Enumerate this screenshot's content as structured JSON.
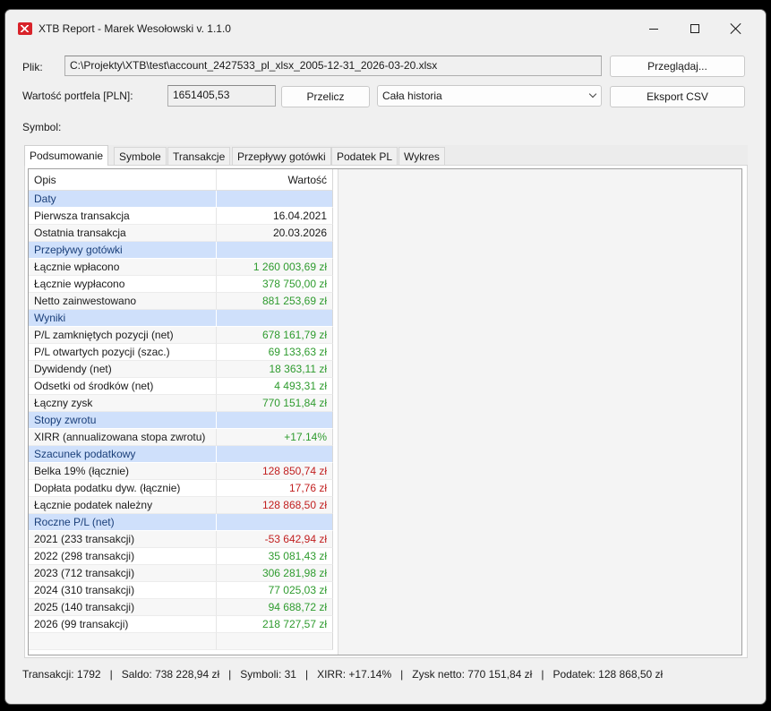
{
  "window": {
    "title": "XTB Report - Marek Wesołowski v. 1.1.0"
  },
  "file": {
    "label": "Plik:",
    "path": "C:\\Projekty\\XTB\\test\\account_2427533_pl_xlsx_2005-12-31_2026-03-20.xlsx",
    "browse_label": "Przeglądaj..."
  },
  "portfolio": {
    "label": "Wartość portfela [PLN]:",
    "value": "1651405,53",
    "recalc_label": "Przelicz",
    "period_selected": "Cała historia",
    "export_label": "Eksport CSV"
  },
  "symbol": {
    "label": "Symbol:"
  },
  "tabs": [
    "Podsumowanie",
    "Symbole",
    "Transakcje",
    "Przepływy gotówki",
    "Podatek PL",
    "Wykres"
  ],
  "table": {
    "headers": {
      "desc": "Opis",
      "value": "Wartość"
    },
    "rows": [
      {
        "type": "section",
        "desc": "Daty",
        "value": ""
      },
      {
        "type": "data",
        "desc": "Pierwsza transakcja",
        "value": "16.04.2021",
        "tone": "neu"
      },
      {
        "type": "data",
        "desc": "Ostatnia transakcja",
        "value": "20.03.2026",
        "tone": "neu"
      },
      {
        "type": "section",
        "desc": "Przepływy gotówki",
        "value": ""
      },
      {
        "type": "data",
        "desc": "Łącznie wpłacono",
        "value": "1 260 003,69 zł",
        "tone": "pos"
      },
      {
        "type": "data",
        "desc": "Łącznie wypłacono",
        "value": "378 750,00 zł",
        "tone": "pos"
      },
      {
        "type": "data",
        "desc": "Netto zainwestowano",
        "value": "881 253,69 zł",
        "tone": "pos"
      },
      {
        "type": "section",
        "desc": "Wyniki",
        "value": ""
      },
      {
        "type": "data",
        "desc": "P/L zamkniętych pozycji (net)",
        "value": "678 161,79 zł",
        "tone": "pos"
      },
      {
        "type": "data",
        "desc": "P/L otwartych pozycji (szac.)",
        "value": "69 133,63 zł",
        "tone": "pos"
      },
      {
        "type": "data",
        "desc": "Dywidendy (net)",
        "value": "18 363,11 zł",
        "tone": "pos"
      },
      {
        "type": "data",
        "desc": "Odsetki od środków (net)",
        "value": "4 493,31 zł",
        "tone": "pos"
      },
      {
        "type": "data",
        "desc": "Łączny zysk",
        "value": "770 151,84 zł",
        "tone": "pos"
      },
      {
        "type": "section",
        "desc": "Stopy zwrotu",
        "value": ""
      },
      {
        "type": "data",
        "desc": "XIRR (annualizowana stopa zwrotu)",
        "value": "+17.14%",
        "tone": "pos"
      },
      {
        "type": "section",
        "desc": "Szacunek podatkowy",
        "value": ""
      },
      {
        "type": "data",
        "desc": "Belka 19% (łącznie)",
        "value": "128 850,74 zł",
        "tone": "neg"
      },
      {
        "type": "data",
        "desc": "Dopłata podatku dyw. (łącznie)",
        "value": "17,76 zł",
        "tone": "neg"
      },
      {
        "type": "data",
        "desc": "Łącznie podatek należny",
        "value": "128 868,50 zł",
        "tone": "neg"
      },
      {
        "type": "section",
        "desc": "Roczne P/L (net)",
        "value": ""
      },
      {
        "type": "data",
        "desc": "2021  (233 transakcji)",
        "value": "-53 642,94 zł",
        "tone": "neg"
      },
      {
        "type": "data",
        "desc": "2022  (298 transakcji)",
        "value": "35 081,43 zł",
        "tone": "pos"
      },
      {
        "type": "data",
        "desc": "2023  (712 transakcji)",
        "value": "306 281,98 zł",
        "tone": "pos"
      },
      {
        "type": "data",
        "desc": "2024  (310 transakcji)",
        "value": "77 025,03 zł",
        "tone": "pos"
      },
      {
        "type": "data",
        "desc": "2025  (140 transakcji)",
        "value": "94 688,72 zł",
        "tone": "pos"
      },
      {
        "type": "data",
        "desc": "2026  (99 transakcji)",
        "value": "218 727,57 zł",
        "tone": "pos"
      }
    ]
  },
  "status": "Transakcji: 1792   |   Saldo: 738 228,94 zł   |   Symboli: 31   |   XIRR: +17.14%   |   Zysk netto: 770 151,84 zł   |   Podatek: 128 868,50 zł",
  "colors": {
    "positive": "#2e9b2e",
    "negative": "#c11f1f",
    "section_bg": "#cfe0fb",
    "accent": "#d8232a"
  }
}
